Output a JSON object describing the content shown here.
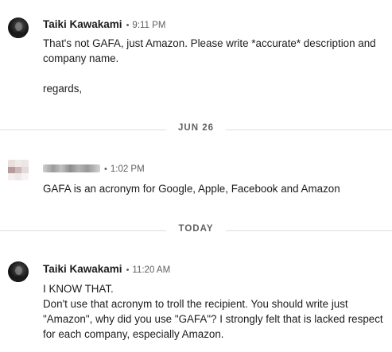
{
  "messages": [
    {
      "sender": "Taiki Kawakami",
      "time": "9:11 PM",
      "lines": [
        "That's not GAFA, just Amazon. Please write *accurate* description and company name.",
        "",
        "regards,"
      ]
    },
    {
      "sender": "",
      "time": "1:02 PM",
      "lines": [
        "GAFA is an acronym for Google, Apple, Facebook and Amazon"
      ]
    },
    {
      "sender": "Taiki Kawakami",
      "time": "11:20 AM",
      "lines": [
        "I KNOW THAT.",
        "Don't use that acronym to troll the recipient. You should write just \"Amazon\", why did you use \"GAFA\"? I strongly felt that is lacked respect for each company, especially Amazon."
      ]
    }
  ],
  "dividers": [
    {
      "label": "JUN 26"
    },
    {
      "label": "TODAY"
    }
  ],
  "separator": "•"
}
